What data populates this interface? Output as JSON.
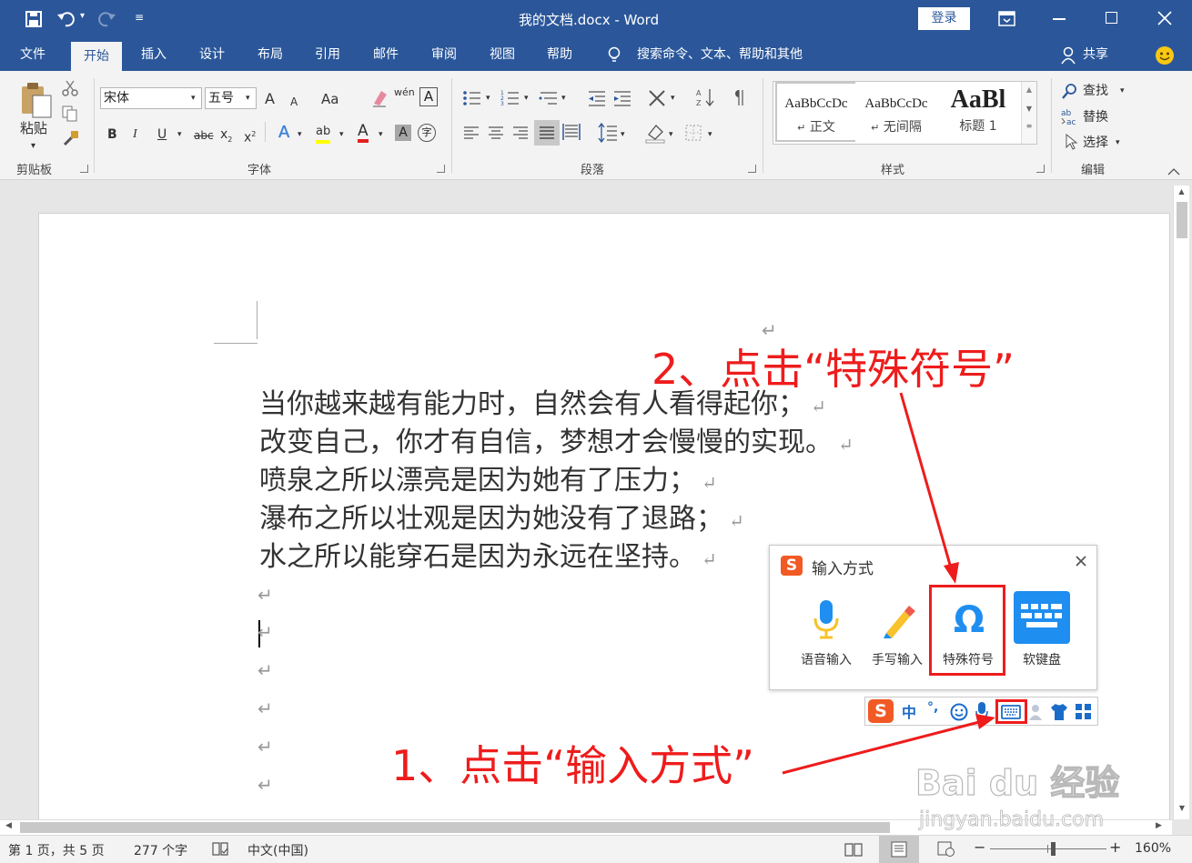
{
  "window": {
    "title": "我的文档.docx  -  Word",
    "signin": "登录"
  },
  "tabs": [
    "文件",
    "开始",
    "插入",
    "设计",
    "布局",
    "引用",
    "邮件",
    "审阅",
    "视图",
    "帮助"
  ],
  "tell_me": "搜索命令、文本、帮助和其他",
  "share": "共享",
  "ribbon": {
    "clipboard": {
      "paste": "粘贴",
      "label": "剪贴板"
    },
    "font": {
      "name": "宋体",
      "size": "五号",
      "label": "字体",
      "grow": "A",
      "shrink": "A",
      "case": "Aa",
      "bold": "B",
      "italic": "I",
      "underline": "U",
      "strike": "abc",
      "sub": "x",
      "sup": "x",
      "effects": "A",
      "highlight": "ab",
      "color": "A",
      "shade": "A",
      "pinyin": "wén",
      "circle": "字"
    },
    "paragraph": {
      "label": "段落"
    },
    "styles": {
      "label": "样式",
      "items": [
        {
          "preview": "AaBbCcDc",
          "name": "正文"
        },
        {
          "preview": "AaBbCcDc",
          "name": "无间隔"
        },
        {
          "preview": "AaBl",
          "name": "标题 1"
        }
      ]
    },
    "editing": {
      "find": "查找",
      "replace": "替换",
      "select": "选择",
      "label": "编辑"
    }
  },
  "document": {
    "lines": [
      "当你越来越有能力时，自然会有人看得起你；",
      "改变自己，你才有自信，梦想才会慢慢的实现。",
      "喷泉之所以漂亮是因为她有了压力；",
      "瀑布之所以壮观是因为她没有了退路；",
      "水之所以能穿石是因为永远在坚持。"
    ],
    "para_mark": "↵"
  },
  "ime_panel": {
    "title": "输入方式",
    "buttons": [
      "语音输入",
      "手写输入",
      "特殊符号",
      "软键盘"
    ]
  },
  "ime_toolbar": {
    "logo": "S",
    "mode": "中",
    "punct": "°,"
  },
  "annotations": {
    "step1": "1、点击“输入方式”",
    "step2": "2、点击“特殊符号”"
  },
  "watermark": {
    "logo": "Bai  du 经验",
    "url": "jingyan.baidu.com"
  },
  "status": {
    "page": "第 1 页，共 5 页",
    "words": "277 个字",
    "lang": "中文(中国)",
    "zoom": "160%"
  },
  "colors": {
    "word_blue": "#2b579a",
    "annotation_red": "#ee1c1c",
    "ime_orange": "#f15a24"
  }
}
